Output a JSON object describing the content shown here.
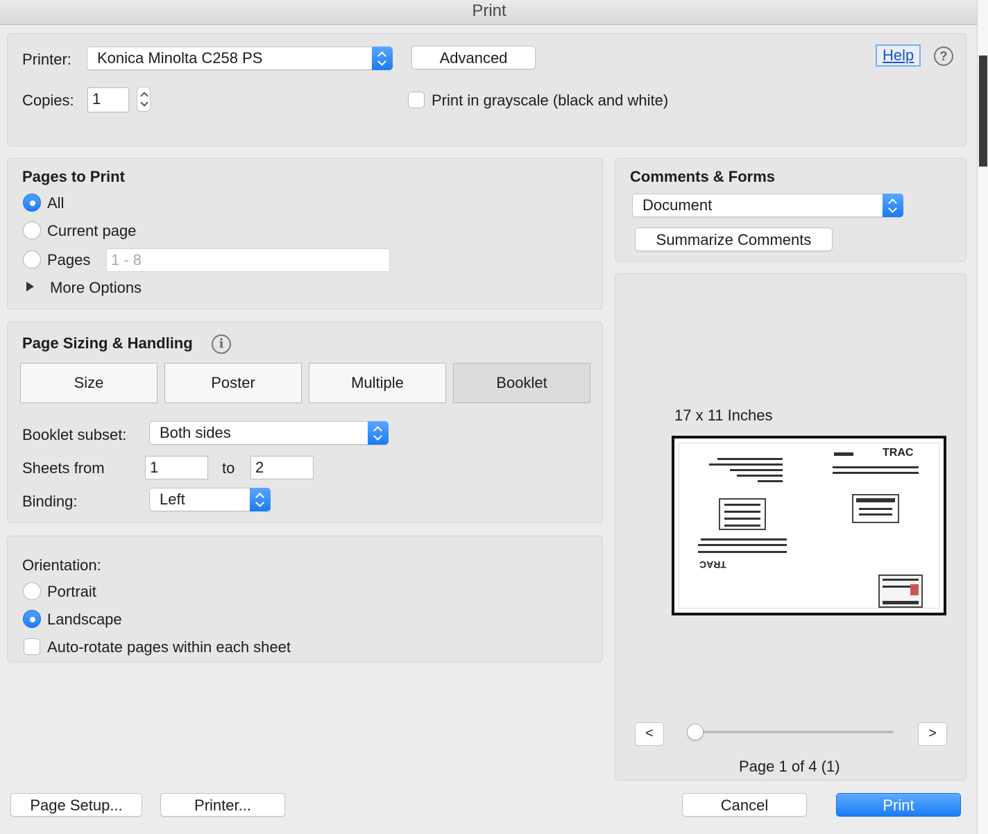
{
  "window": {
    "title": "Print"
  },
  "header": {
    "printer_label": "Printer:",
    "printer_value": "Konica Minolta C258 PS",
    "advanced_label": "Advanced",
    "help_label": "Help",
    "help_icon_glyph": "?",
    "copies_label": "Copies:",
    "copies_value": "1",
    "grayscale_label": "Print in grayscale (black and white)"
  },
  "pages_to_print": {
    "title": "Pages to Print",
    "all_label": "All",
    "current_label": "Current page",
    "pages_label": "Pages",
    "pages_placeholder": "1 - 8",
    "more_options_label": "More Options",
    "selected": "All"
  },
  "sizing": {
    "title": "Page Sizing & Handling",
    "info_glyph": "i",
    "tabs": [
      "Size",
      "Poster",
      "Multiple",
      "Booklet"
    ],
    "selected_tab": "Booklet",
    "subset_label": "Booklet subset:",
    "subset_value": "Both sides",
    "sheets_from_label": "Sheets from",
    "sheets_from_value": "1",
    "to_label": "to",
    "sheets_to_value": "2",
    "binding_label": "Binding:",
    "binding_value": "Left"
  },
  "orientation": {
    "title": "Orientation:",
    "portrait_label": "Portrait",
    "landscape_label": "Landscape",
    "autorotate_label": "Auto-rotate pages within each sheet",
    "selected": "Landscape"
  },
  "comments": {
    "title": "Comments & Forms",
    "value": "Document",
    "summarize_label": "Summarize Comments"
  },
  "preview": {
    "size_label": "17 x 11 Inches",
    "logo_text": "TRAC",
    "prev_label": "<",
    "next_label": ">",
    "page_status": "Page 1 of 4 (1)",
    "slider_position": 0
  },
  "footer": {
    "page_setup_label": "Page Setup...",
    "printer_label": "Printer...",
    "cancel_label": "Cancel",
    "print_label": "Print"
  },
  "colors": {
    "accent": "#1a7cf3",
    "link": "#1a55c8"
  }
}
